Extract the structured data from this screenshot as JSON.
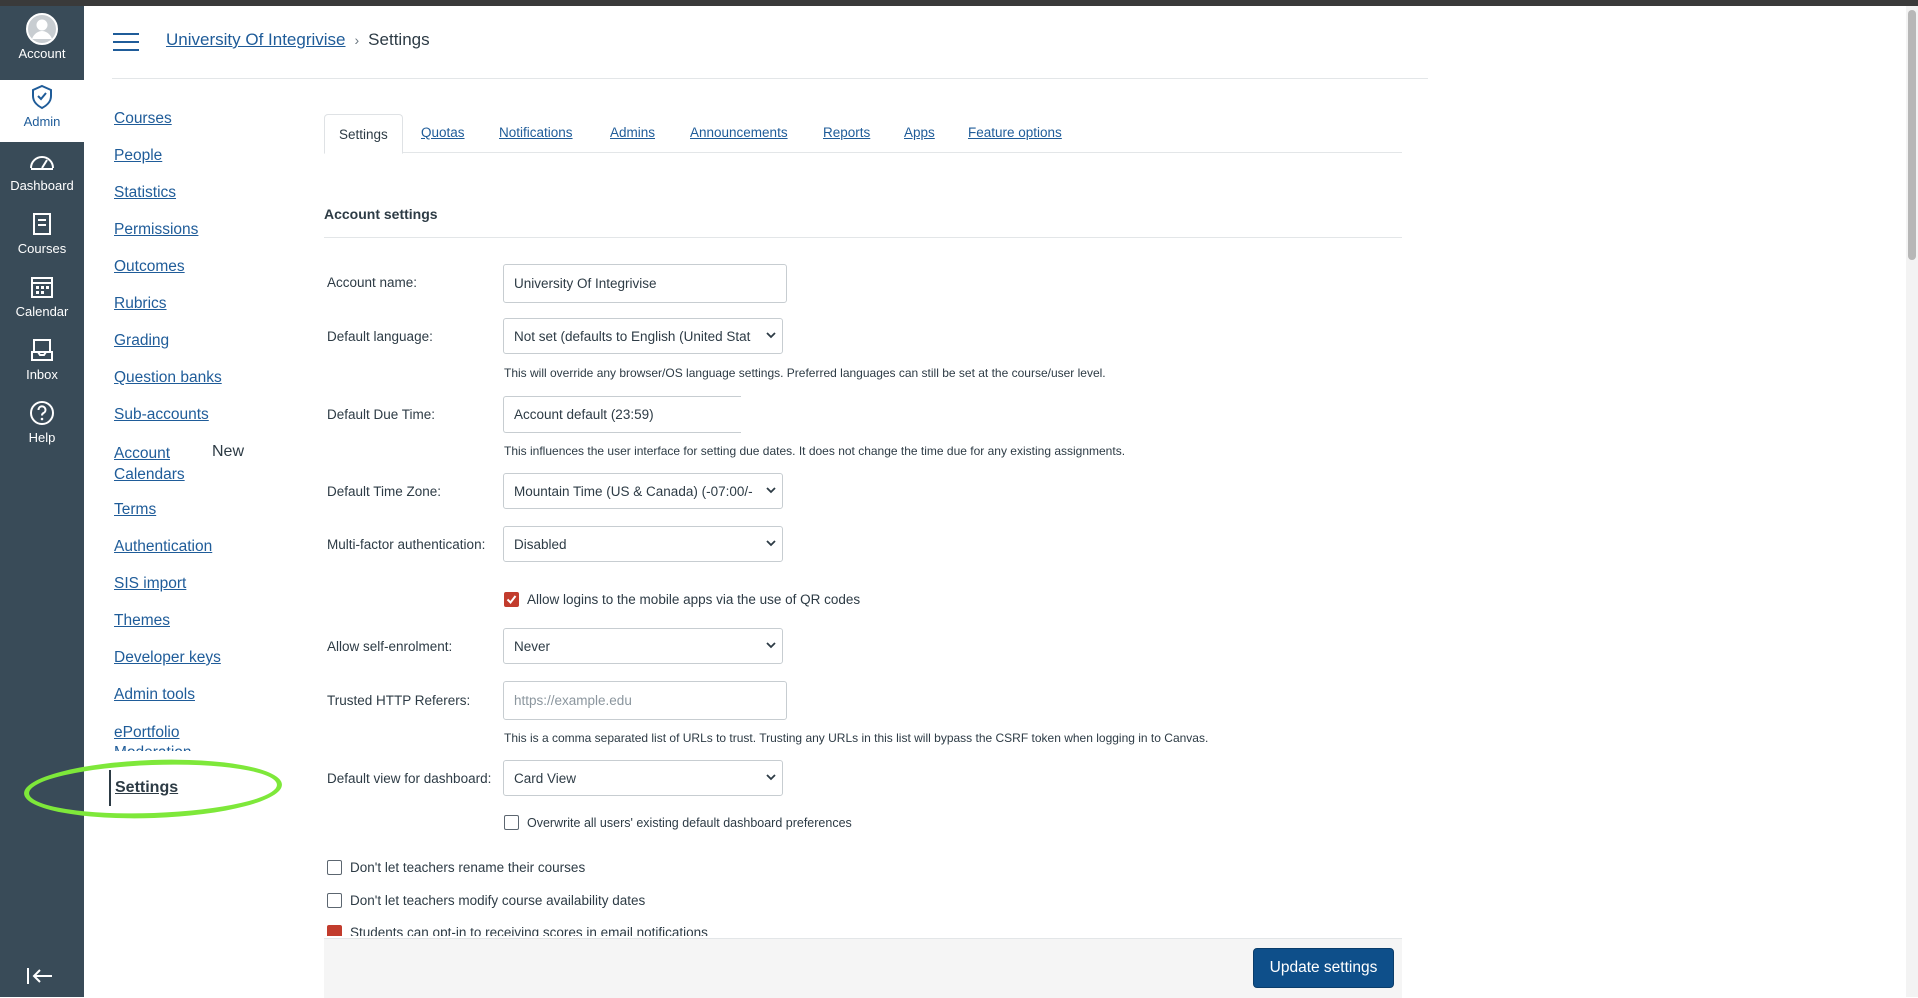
{
  "global_nav": [
    {
      "label": "Account",
      "icon": "user-avatar-icon"
    },
    {
      "label": "Admin",
      "icon": "shield-icon"
    },
    {
      "label": "Dashboard",
      "icon": "dashboard-icon"
    },
    {
      "label": "Courses",
      "icon": "book-icon"
    },
    {
      "label": "Calendar",
      "icon": "calendar-icon"
    },
    {
      "label": "Inbox",
      "icon": "inbox-icon"
    },
    {
      "label": "Help",
      "icon": "help-icon"
    }
  ],
  "breadcrumb": {
    "root": "University Of Integrivise",
    "current": "Settings"
  },
  "subnav": {
    "items": [
      "Courses",
      "People",
      "Statistics",
      "Permissions",
      "Outcomes",
      "Rubrics",
      "Grading",
      "Question banks",
      "Sub-accounts",
      "Account Calendars",
      "Terms",
      "Authentication",
      "SIS import",
      "Themes",
      "Developer keys",
      "Admin tools",
      "ePortfolio Moderation",
      "Settings"
    ],
    "new_badge": "New"
  },
  "tabs": [
    "Settings",
    "Quotas",
    "Notifications",
    "Admins",
    "Announcements",
    "Reports",
    "Apps",
    "Feature options"
  ],
  "section_title": "Account settings",
  "form": {
    "account_name_label": "Account name:",
    "account_name_value": "University Of Integrivise",
    "default_language_label": "Default language:",
    "default_language_value": "Not set (defaults to English (United Stat",
    "default_language_hint": "This will override any browser/OS language settings. Preferred languages can still be set at the course/user level.",
    "due_time_label": "Default Due Time:",
    "due_time_value": "Account default (23:59)",
    "due_time_hint": "This influences the user interface for setting due dates. It does not change the time due for any existing assignments.",
    "time_zone_label": "Default Time Zone:",
    "time_zone_value": "Mountain Time (US & Canada) (-07:00/-",
    "mfa_label": "Multi-factor authentication:",
    "mfa_value": "Disabled",
    "qr_login_label": "Allow logins to the mobile apps via the use of QR codes",
    "self_enrol_label": "Allow self-enrolment:",
    "self_enrol_value": "Never",
    "http_referers_label": "Trusted HTTP Referers:",
    "http_referers_placeholder": "https://example.edu",
    "http_referers_hint": "This is a comma separated list of URLs to trust. Trusting any URLs in this list will bypass the CSRF token when logging in to Canvas.",
    "dashboard_view_label": "Default view for dashboard:",
    "dashboard_view_value": "Card View",
    "overwrite_label": "Overwrite all users' existing default dashboard preferences",
    "no_rename_label": "Don't let teachers rename their courses",
    "no_availability_label": "Don't let teachers modify course availability dates",
    "scores_email_label": "Students can opt-in to receiving scores in email notifications"
  },
  "update_button": "Update settings",
  "colors": {
    "nav_bg": "#394b58",
    "link": "#1f5c99",
    "primary_button": "#0e4f8a",
    "checkbox_on": "#c23c2d",
    "highlight": "#7ee83a"
  }
}
